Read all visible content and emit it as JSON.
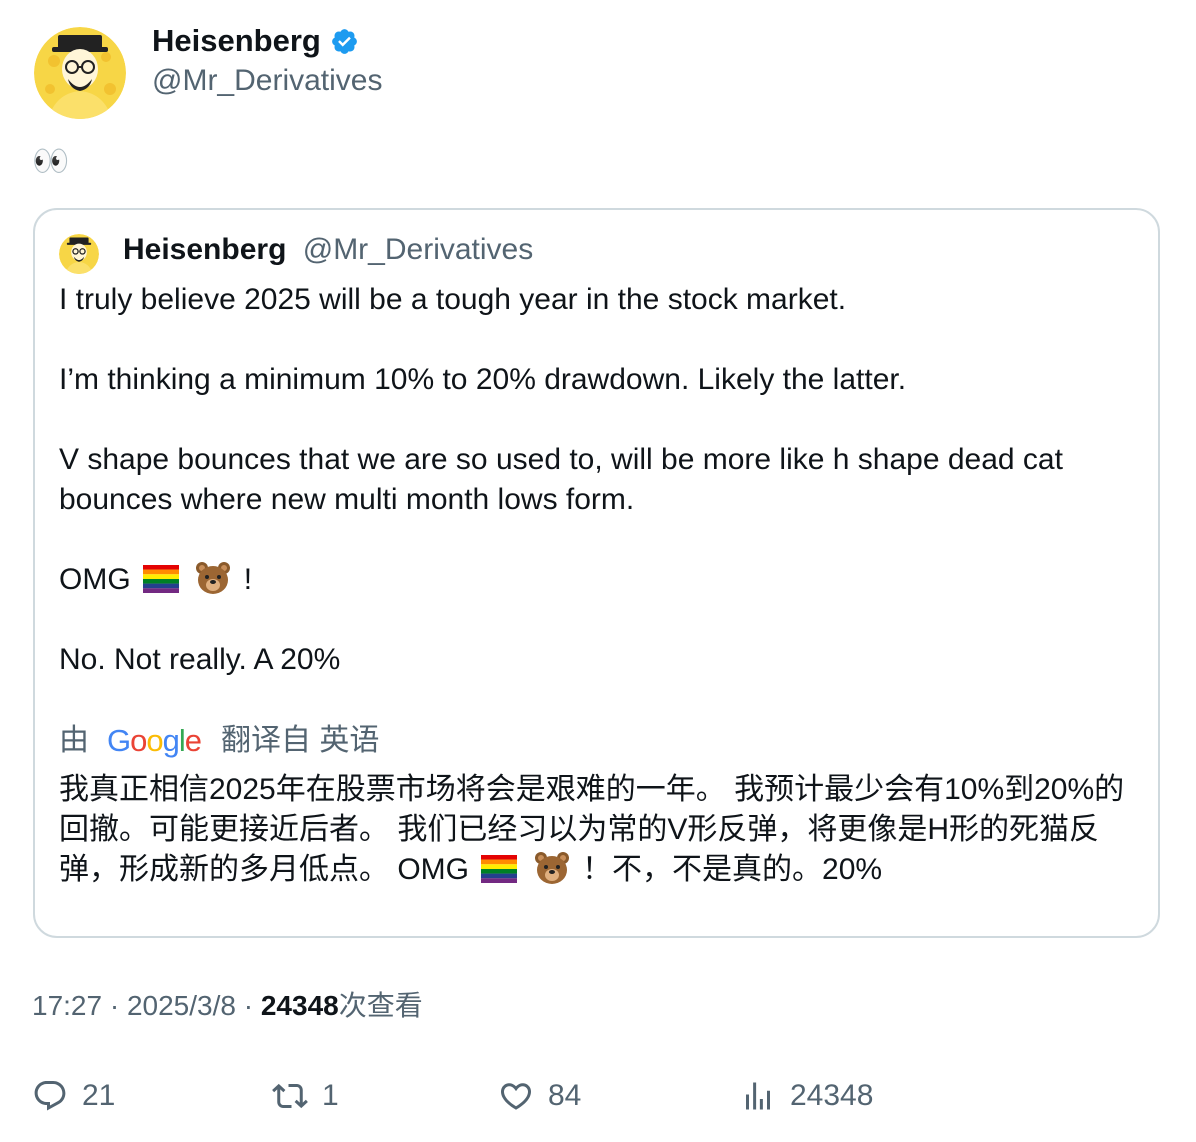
{
  "author": {
    "display_name": "Heisenberg",
    "handle": "@Mr_Derivatives",
    "verified": true
  },
  "tweet": {
    "text": "👀"
  },
  "quoted_tweet": {
    "display_name": "Heisenberg",
    "handle": "@Mr_Derivatives",
    "paragraphs": [
      "I truly believe 2025 will be a tough year in the stock market.",
      "I’m thinking a minimum 10% to 20% drawdown. Likely the latter.",
      "V shape bounces that we are so used to, will be more like h shape dead cat bounces where new multi month lows form.",
      "OMG",
      "!",
      "No. Not really. A 20%"
    ],
    "translation": {
      "prefix": "由",
      "provider": "Google",
      "suffix": "翻译自 英语",
      "text_part1": "我真正相信2025年在股票市场将会是艰难的一年。 我预计最少会有10%到20%的回撤。可能更接近后者。 我们已经习以为常的V形反弹，将更像是H形的死猫反弹，形成新的多月低点。 OMG",
      "text_part2": "！不，不是真的。20%"
    }
  },
  "meta": {
    "time": "17:27",
    "separator": "·",
    "date": "2025/3/8",
    "views_count": "24348",
    "views_label": "次查看"
  },
  "actions": {
    "replies": "21",
    "retweets": "1",
    "likes": "84",
    "views": "24348"
  },
  "icons": {
    "reply": "speech-bubble-icon",
    "retweet": "retweet-arrows-icon",
    "like": "heart-icon",
    "views": "bar-chart-icon",
    "verified": "verified-badge-icon"
  },
  "colors": {
    "verified_blue": "#1d9bf0",
    "secondary_text": "#536471",
    "primary_text": "#0f1419",
    "card_border": "#cfd9de"
  }
}
